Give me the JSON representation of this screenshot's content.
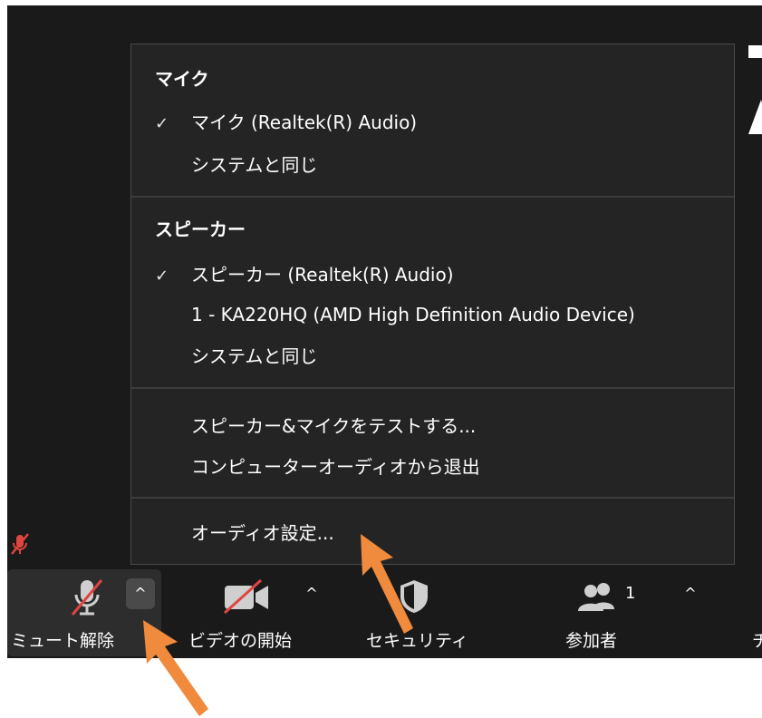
{
  "menu": {
    "mic_section": {
      "heading": "マイク",
      "items": [
        {
          "label": "マイク (Realtek(R) Audio)",
          "checked": true
        },
        {
          "label": "システムと同じ",
          "checked": false
        }
      ]
    },
    "speaker_section": {
      "heading": "スピーカー",
      "items": [
        {
          "label": "スピーカー (Realtek(R) Audio)",
          "checked": true
        },
        {
          "label": "1 - KA220HQ (AMD High Definition Audio Device)",
          "checked": false
        },
        {
          "label": "システムと同じ",
          "checked": false
        }
      ]
    },
    "actions": [
      {
        "label": "スピーカー&マイクをテストする..."
      },
      {
        "label": "コンピューターオーディオから退出"
      }
    ],
    "settings": {
      "label": "オーディオ設定..."
    },
    "check_mark": "✓"
  },
  "toolbar": {
    "unmute_label": "ミュート解除",
    "audio_caret": "^",
    "video_label": "ビデオの開始",
    "video_caret": "^",
    "security_label": "セキュリティ",
    "participants_label": "参加者",
    "participants_count": "1",
    "participants_caret": "^",
    "cutoff_label": "チ"
  },
  "icons": {
    "mic": "mic-muted-icon",
    "video": "video-off-icon",
    "security": "shield-icon",
    "participants": "people-icon",
    "muted_indicator": "mic-muted-small-icon",
    "annotation_arrow": "orange-arrow"
  },
  "colors": {
    "app_bg": "#1a1a1a",
    "menu_bg": "#242424",
    "mute_red": "#e0453f",
    "arrow_orange": "#f08a3c"
  }
}
